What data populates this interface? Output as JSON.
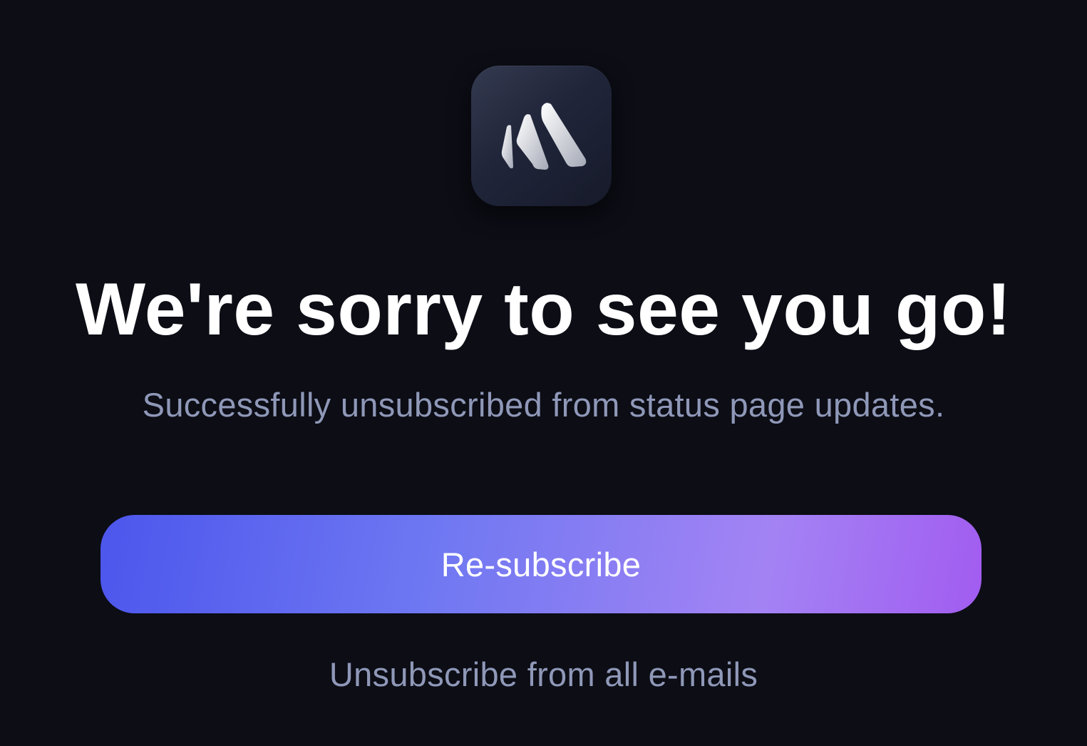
{
  "brand": {
    "logo_icon": "mountain-stripes-logo-icon",
    "tile_color": "#232839"
  },
  "headline": "We're sorry to see you go!",
  "subtext": "Successfully unsubscribed from status page updates.",
  "actions": {
    "resubscribe_label": "Re-subscribe",
    "unsubscribe_all_label": "Unsubscribe from all e-mails"
  },
  "colors": {
    "background": "#0c0d15",
    "button_gradient_start": "#4c56ec",
    "button_gradient_end": "#a25cf0",
    "muted_text": "#8f98b8"
  }
}
